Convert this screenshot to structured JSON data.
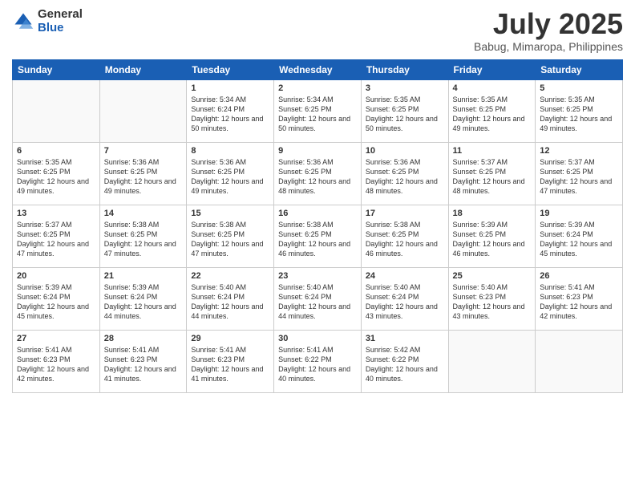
{
  "logo": {
    "general": "General",
    "blue": "Blue"
  },
  "header": {
    "title": "July 2025",
    "subtitle": "Babug, Mimaropa, Philippines"
  },
  "weekdays": [
    "Sunday",
    "Monday",
    "Tuesday",
    "Wednesday",
    "Thursday",
    "Friday",
    "Saturday"
  ],
  "weeks": [
    [
      {
        "day": "",
        "info": ""
      },
      {
        "day": "",
        "info": ""
      },
      {
        "day": "1",
        "info": "Sunrise: 5:34 AM\nSunset: 6:24 PM\nDaylight: 12 hours and 50 minutes."
      },
      {
        "day": "2",
        "info": "Sunrise: 5:34 AM\nSunset: 6:25 PM\nDaylight: 12 hours and 50 minutes."
      },
      {
        "day": "3",
        "info": "Sunrise: 5:35 AM\nSunset: 6:25 PM\nDaylight: 12 hours and 50 minutes."
      },
      {
        "day": "4",
        "info": "Sunrise: 5:35 AM\nSunset: 6:25 PM\nDaylight: 12 hours and 49 minutes."
      },
      {
        "day": "5",
        "info": "Sunrise: 5:35 AM\nSunset: 6:25 PM\nDaylight: 12 hours and 49 minutes."
      }
    ],
    [
      {
        "day": "6",
        "info": "Sunrise: 5:35 AM\nSunset: 6:25 PM\nDaylight: 12 hours and 49 minutes."
      },
      {
        "day": "7",
        "info": "Sunrise: 5:36 AM\nSunset: 6:25 PM\nDaylight: 12 hours and 49 minutes."
      },
      {
        "day": "8",
        "info": "Sunrise: 5:36 AM\nSunset: 6:25 PM\nDaylight: 12 hours and 49 minutes."
      },
      {
        "day": "9",
        "info": "Sunrise: 5:36 AM\nSunset: 6:25 PM\nDaylight: 12 hours and 48 minutes."
      },
      {
        "day": "10",
        "info": "Sunrise: 5:36 AM\nSunset: 6:25 PM\nDaylight: 12 hours and 48 minutes."
      },
      {
        "day": "11",
        "info": "Sunrise: 5:37 AM\nSunset: 6:25 PM\nDaylight: 12 hours and 48 minutes."
      },
      {
        "day": "12",
        "info": "Sunrise: 5:37 AM\nSunset: 6:25 PM\nDaylight: 12 hours and 47 minutes."
      }
    ],
    [
      {
        "day": "13",
        "info": "Sunrise: 5:37 AM\nSunset: 6:25 PM\nDaylight: 12 hours and 47 minutes."
      },
      {
        "day": "14",
        "info": "Sunrise: 5:38 AM\nSunset: 6:25 PM\nDaylight: 12 hours and 47 minutes."
      },
      {
        "day": "15",
        "info": "Sunrise: 5:38 AM\nSunset: 6:25 PM\nDaylight: 12 hours and 47 minutes."
      },
      {
        "day": "16",
        "info": "Sunrise: 5:38 AM\nSunset: 6:25 PM\nDaylight: 12 hours and 46 minutes."
      },
      {
        "day": "17",
        "info": "Sunrise: 5:38 AM\nSunset: 6:25 PM\nDaylight: 12 hours and 46 minutes."
      },
      {
        "day": "18",
        "info": "Sunrise: 5:39 AM\nSunset: 6:25 PM\nDaylight: 12 hours and 46 minutes."
      },
      {
        "day": "19",
        "info": "Sunrise: 5:39 AM\nSunset: 6:24 PM\nDaylight: 12 hours and 45 minutes."
      }
    ],
    [
      {
        "day": "20",
        "info": "Sunrise: 5:39 AM\nSunset: 6:24 PM\nDaylight: 12 hours and 45 minutes."
      },
      {
        "day": "21",
        "info": "Sunrise: 5:39 AM\nSunset: 6:24 PM\nDaylight: 12 hours and 44 minutes."
      },
      {
        "day": "22",
        "info": "Sunrise: 5:40 AM\nSunset: 6:24 PM\nDaylight: 12 hours and 44 minutes."
      },
      {
        "day": "23",
        "info": "Sunrise: 5:40 AM\nSunset: 6:24 PM\nDaylight: 12 hours and 44 minutes."
      },
      {
        "day": "24",
        "info": "Sunrise: 5:40 AM\nSunset: 6:24 PM\nDaylight: 12 hours and 43 minutes."
      },
      {
        "day": "25",
        "info": "Sunrise: 5:40 AM\nSunset: 6:23 PM\nDaylight: 12 hours and 43 minutes."
      },
      {
        "day": "26",
        "info": "Sunrise: 5:41 AM\nSunset: 6:23 PM\nDaylight: 12 hours and 42 minutes."
      }
    ],
    [
      {
        "day": "27",
        "info": "Sunrise: 5:41 AM\nSunset: 6:23 PM\nDaylight: 12 hours and 42 minutes."
      },
      {
        "day": "28",
        "info": "Sunrise: 5:41 AM\nSunset: 6:23 PM\nDaylight: 12 hours and 41 minutes."
      },
      {
        "day": "29",
        "info": "Sunrise: 5:41 AM\nSunset: 6:23 PM\nDaylight: 12 hours and 41 minutes."
      },
      {
        "day": "30",
        "info": "Sunrise: 5:41 AM\nSunset: 6:22 PM\nDaylight: 12 hours and 40 minutes."
      },
      {
        "day": "31",
        "info": "Sunrise: 5:42 AM\nSunset: 6:22 PM\nDaylight: 12 hours and 40 minutes."
      },
      {
        "day": "",
        "info": ""
      },
      {
        "day": "",
        "info": ""
      }
    ]
  ]
}
